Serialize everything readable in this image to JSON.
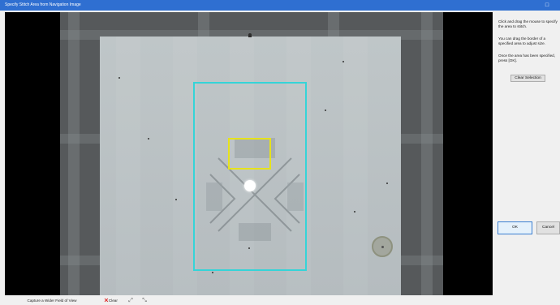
{
  "window": {
    "title": "Specify Stitch Area from Navigation Image",
    "close_glyph": "□"
  },
  "instructions": {
    "line1": "Click and drag the mouse to specify the area to stitch.",
    "line2": "You can drag the border of a specified area to adjust size.",
    "line3": "Once the area has been specified, press [OK]."
  },
  "buttons": {
    "clear_selection": "Clear Selection",
    "ok": "OK",
    "cancel": "Cancel"
  },
  "toolbar": {
    "wider_view": "Capture a Wider Field of View",
    "clear": "Clear",
    "clear_icon": "red-x",
    "tool1_glyph": "⤢",
    "tool2_glyph": "⤡"
  },
  "colors": {
    "titlebar": "#2f6fd1",
    "stitch_area": "#35d4d8",
    "current_view": "#e6e21c"
  }
}
